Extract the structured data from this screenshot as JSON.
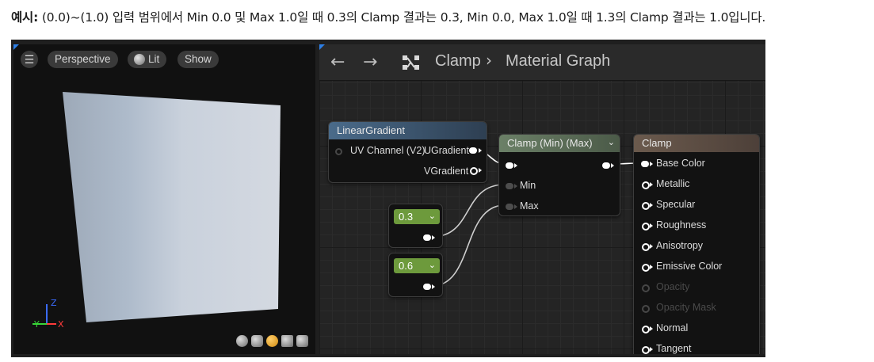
{
  "caption": {
    "label": "예시:",
    "text": "(0.0)~(1.0) 입력 범위에서 Min 0.0 및 Max 1.0일 때 0.3의 Clamp 결과는 0.3, Min 0.0, Max 1.0일 때 1.3의 Clamp 결과는 1.0입니다."
  },
  "viewport": {
    "menu_icon": "hamburger-icon",
    "perspective_label": "Perspective",
    "lit_label": "Lit",
    "show_label": "Show",
    "axis_labels": {
      "z": "Z",
      "y": "Y",
      "x": "X"
    },
    "preview_tools": [
      "sphere-preview-icon",
      "cylinder-preview-icon",
      "plane-preview-icon",
      "cube-preview-icon",
      "custom-mesh-icon"
    ]
  },
  "graph": {
    "back_icon": "arrow-left-icon",
    "forward_icon": "arrow-right-icon",
    "graph_icon": "material-graph-icon",
    "breadcrumb": {
      "asset": "Clamp",
      "separator": "›",
      "page": "Material Graph"
    },
    "nodes": {
      "linear_gradient": {
        "title": "LinearGradient",
        "input": "UV Channel (V2)",
        "outputs": [
          "UGradient",
          "VGradient"
        ]
      },
      "clamp": {
        "title": "Clamp (Min) (Max)",
        "inputs": [
          "Min",
          "Max"
        ]
      },
      "const_min": {
        "value": "0.3"
      },
      "const_max": {
        "value": "0.6"
      },
      "result": {
        "title": "Clamp",
        "pins": [
          {
            "label": "Base Color",
            "connected": true,
            "enabled": true
          },
          {
            "label": "Metallic",
            "connected": false,
            "enabled": true
          },
          {
            "label": "Specular",
            "connected": false,
            "enabled": true
          },
          {
            "label": "Roughness",
            "connected": false,
            "enabled": true
          },
          {
            "label": "Anisotropy",
            "connected": false,
            "enabled": true
          },
          {
            "label": "Emissive Color",
            "connected": false,
            "enabled": true
          },
          {
            "label": "Opacity",
            "connected": false,
            "enabled": false
          },
          {
            "label": "Opacity Mask",
            "connected": false,
            "enabled": false
          },
          {
            "label": "Normal",
            "connected": false,
            "enabled": true
          },
          {
            "label": "Tangent",
            "connected": false,
            "enabled": true
          }
        ]
      }
    }
  },
  "colors": {
    "linear_gradient_header": "#4a6b8a",
    "clamp_header": "#6b8067",
    "result_header": "#6b5a4d",
    "constant_header": "#6d9a3c",
    "viewport_corner_accent": "#2d7fe6",
    "lit_selected_tool": "#d08a10",
    "axis_z": "#3b6cff",
    "axis_y": "#37d637",
    "axis_x": "#ff3b3b"
  }
}
